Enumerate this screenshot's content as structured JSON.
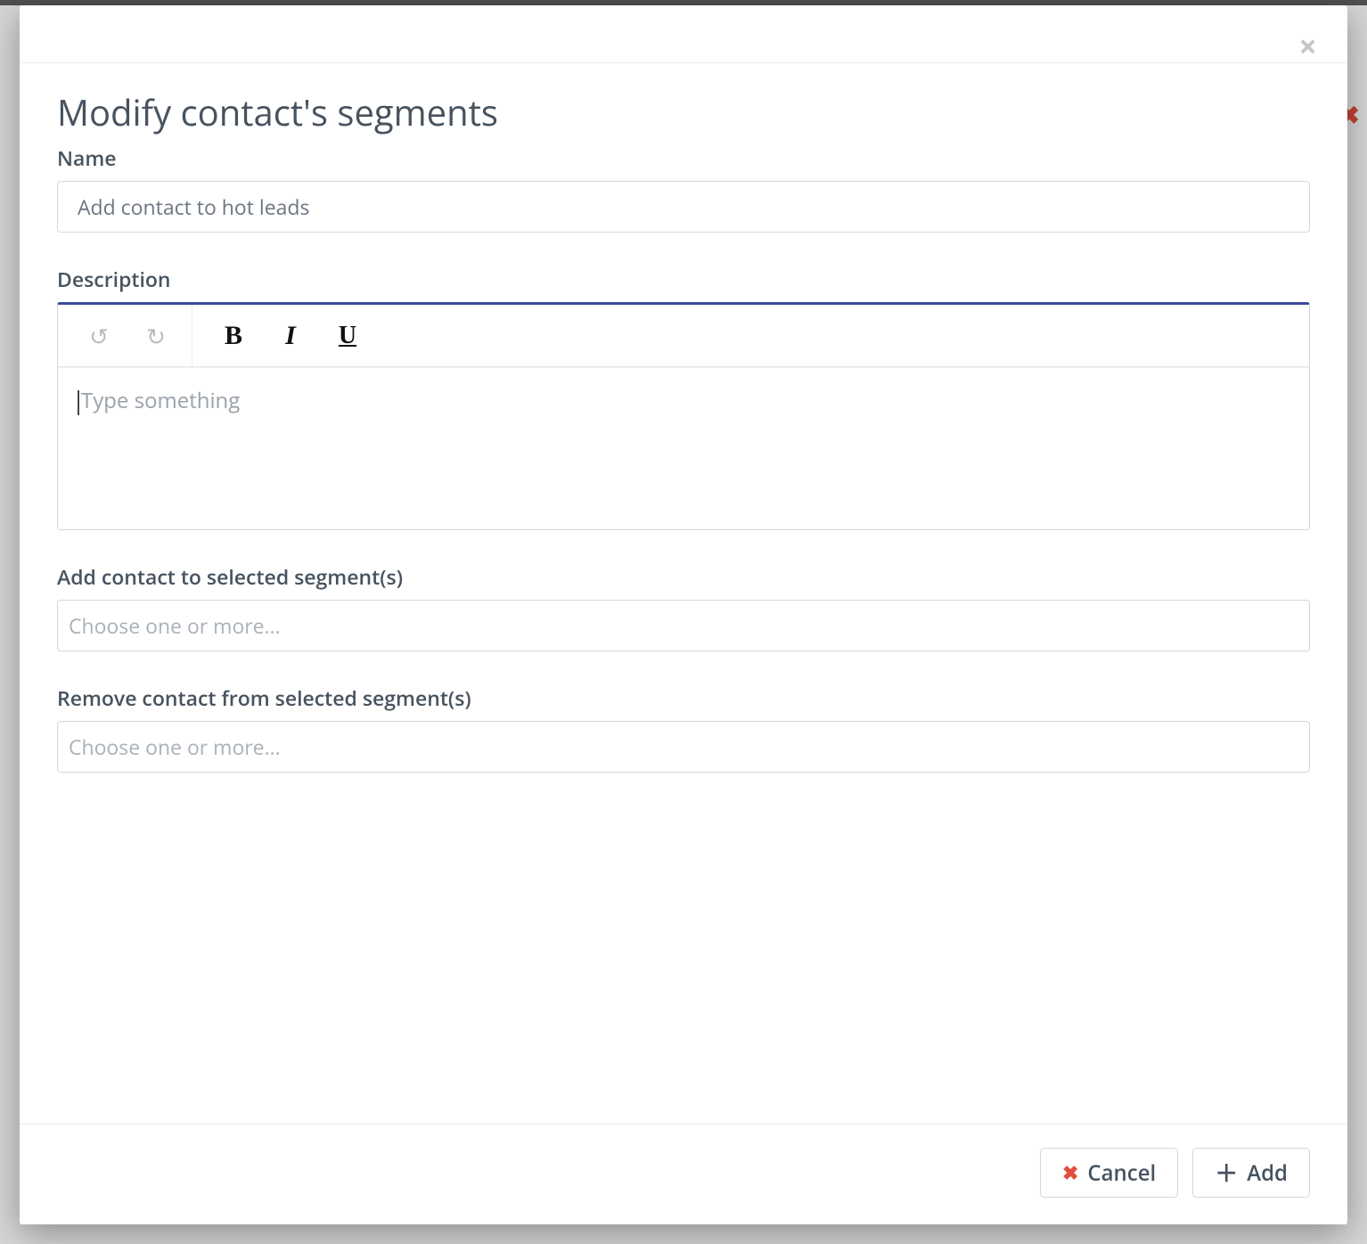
{
  "modal": {
    "title": "Modify contact's segments",
    "close_aria": "Close",
    "fields": {
      "name": {
        "label": "Name",
        "value": "Add contact to hot leads"
      },
      "description": {
        "label": "Description",
        "placeholder": "Type something",
        "toolbar": {
          "undo": "Undo",
          "redo": "Redo",
          "bold": "B",
          "italic": "I",
          "underline": "U"
        }
      },
      "add_segments": {
        "label": "Add contact to selected segment(s)",
        "placeholder": "Choose one or more..."
      },
      "remove_segments": {
        "label": "Remove contact from selected segment(s)",
        "placeholder": "Choose one or more..."
      }
    },
    "footer": {
      "cancel": "Cancel",
      "add": "Add"
    }
  }
}
